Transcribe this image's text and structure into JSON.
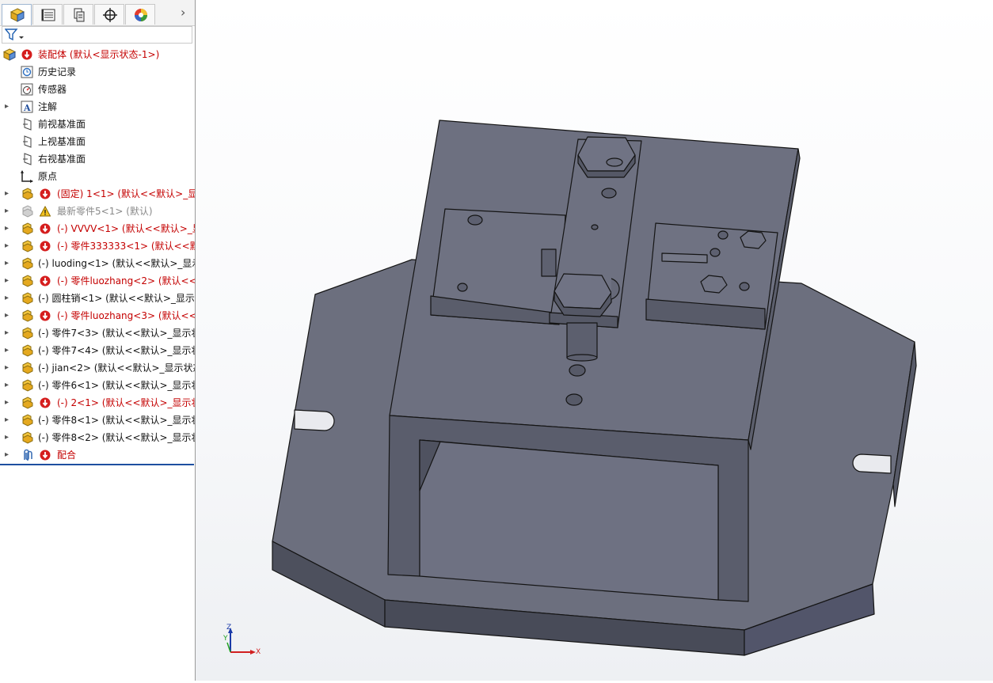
{
  "tabs": [
    {
      "name": "featuremanager-tab",
      "icon": "assembly-cube-icon"
    },
    {
      "name": "propertymanager-tab",
      "icon": "property-list-icon"
    },
    {
      "name": "configurationmanager-tab",
      "icon": "configuration-icon"
    },
    {
      "name": "dimxpert-tab",
      "icon": "crosshair-icon"
    },
    {
      "name": "display-manager-tab",
      "icon": "color-wheel-icon"
    }
  ],
  "tabs_more": "›",
  "filter": {
    "icon": "funnel-icon"
  },
  "tree": {
    "root": {
      "label": "装配体 (默认<显示状态-1>)"
    },
    "history": "历史记录",
    "sensors": "传感器",
    "annotations": "注解",
    "front_plane": "前视基准面",
    "top_plane": "上视基准面",
    "right_plane": "右视基准面",
    "origin": "原点",
    "components": [
      {
        "label": "(固定) 1<1> (默认<<默认>_显示",
        "status": "error"
      },
      {
        "label": "最新零件5<1> (默认)",
        "status": "warning"
      },
      {
        "label": "(-) VVVV<1> (默认<<默认>_显",
        "status": "error"
      },
      {
        "label": "(-) 零件333333<1> (默认<<默认",
        "status": "error"
      },
      {
        "label": "(-) luoding<1> (默认<<默认>_显示",
        "status": "ok"
      },
      {
        "label": "(-) 零件luozhang<2> (默认<<默",
        "status": "error"
      },
      {
        "label": "(-) 圆柱销<1> (默认<<默认>_显示状",
        "status": "ok"
      },
      {
        "label": "(-) 零件luozhang<3> (默认<<默",
        "status": "error"
      },
      {
        "label": "(-) 零件7<3> (默认<<默认>_显示状",
        "status": "ok"
      },
      {
        "label": "(-) 零件7<4> (默认<<默认>_显示状",
        "status": "ok"
      },
      {
        "label": "(-) jian<2> (默认<<默认>_显示状态",
        "status": "ok"
      },
      {
        "label": "(-) 零件6<1> (默认<<默认>_显示状",
        "status": "ok"
      },
      {
        "label": "(-) 2<1> (默认<<默认>_显示状",
        "status": "error"
      },
      {
        "label": "(-) 零件8<1> (默认<<默认>_显示状",
        "status": "ok"
      },
      {
        "label": "(-) 零件8<2> (默认<<默认>_显示状",
        "status": "ok"
      }
    ],
    "mates": "配合"
  },
  "triad": {
    "x": "X",
    "y": "Y",
    "z": "Z"
  },
  "colors": {
    "error": "#c40000",
    "model_face": "#6b6e7d",
    "model_side": "#4c4f5c",
    "model_edge": "#141414",
    "selection_bar": "#1d4fa0"
  }
}
